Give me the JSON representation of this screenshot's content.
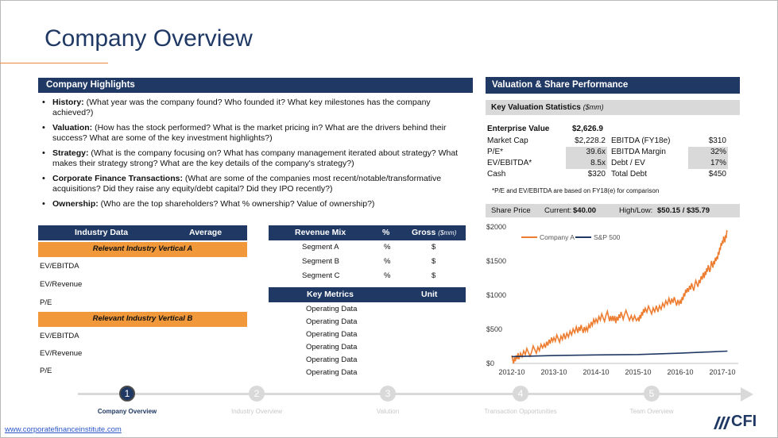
{
  "title": "Company Overview",
  "highlights": {
    "header": "Company Highlights",
    "items": [
      {
        "label": "History:",
        "text": " (What year was the company found? Who founded it? What key milestones has the company achieved?)"
      },
      {
        "label": "Valuation:",
        "text": " (How has the stock performed? What is the market pricing in? What are the drivers behind their success? What are some of the key investment highlights?)"
      },
      {
        "label": "Strategy:",
        "text": " (What is the company focusing on? What has company management iterated about strategy? What makes their strategy strong? What are the key details of the company's strategy?)"
      },
      {
        "label": "Corporate Finance Transactions:",
        "text": " (What are some of the companies most recent/notable/transformative acquisitions? Did they raise any equity/debt capital? Did they IPO recently?)"
      },
      {
        "label": "Ownership:",
        "text": " (Who are the top shareholders? What % ownership? Value of ownership?)"
      }
    ]
  },
  "industry": {
    "col1": "Industry Data",
    "col2": "Average",
    "group_a": "Relevant Industry Vertical A",
    "group_b": "Relevant Industry Vertical B",
    "rows_a": [
      "EV/EBITDA",
      "EV/Revenue",
      "P/E"
    ],
    "rows_b": [
      "EV/EBITDA",
      "EV/Revenue",
      "P/E"
    ]
  },
  "revenue_mix": {
    "col1": "Revenue Mix",
    "col2": "%",
    "col3": "Gross",
    "col3_unit": "($mm)",
    "rows": [
      {
        "name": "Segment A",
        "pct": "%",
        "gross": "$"
      },
      {
        "name": "Segment B",
        "pct": "%",
        "gross": "$"
      },
      {
        "name": "Segment C",
        "pct": "%",
        "gross": "$"
      }
    ]
  },
  "key_metrics": {
    "col1": "Key Metrics",
    "col2": "Unit",
    "rows": [
      "Operating Data",
      "Operating Data",
      "Operating Data",
      "Operating Data",
      "Operating Data",
      "Operating Data"
    ]
  },
  "valuation": {
    "header": "Valuation & Share Performance",
    "kvs_label": "Key Valuation Statistics",
    "kvs_unit": "($mm)",
    "ev_label": "Enterprise Value",
    "ev_value": "$2,626.9",
    "left": [
      {
        "label": "Market Cap",
        "value": "$2,228.2"
      },
      {
        "label": "P/E*",
        "value": "39.6x"
      },
      {
        "label": "EV/EBITDA*",
        "value": "8.5x"
      },
      {
        "label": "Cash",
        "value": "$320"
      }
    ],
    "right": [
      {
        "label": "EBITDA (FY18e)",
        "value": "$310"
      },
      {
        "label": "EBITDA Margin",
        "value": "32%"
      },
      {
        "label": "Debt / EV",
        "value": "17%"
      },
      {
        "label": "Total Debt",
        "value": "$450"
      }
    ],
    "note": "*P/E and EV/EBITDA are based on FY18(e) for comparison"
  },
  "share_price": {
    "label": "Share Price",
    "current_label": "Current:",
    "current_value": "$40.00",
    "hl_label": "High/Low:",
    "hl_value": "$50.15 / $35.79"
  },
  "chart_data": {
    "type": "line",
    "title": "",
    "xlabel": "",
    "ylabel": "",
    "x_ticks": [
      "2012-10",
      "2013-10",
      "2014-10",
      "2015-10",
      "2016-10",
      "2017-10"
    ],
    "y_ticks": [
      "$0",
      "$500",
      "$1000",
      "$1500",
      "$2000"
    ],
    "ylim": [
      0,
      2000
    ],
    "legend_position": "top-left",
    "series": [
      {
        "name": "Company A",
        "color": "#ed7d31",
        "x": [
          2012.83,
          2013.0,
          2013.3,
          2013.6,
          2013.83,
          2014.1,
          2014.4,
          2014.6,
          2014.83,
          2015.1,
          2015.3,
          2015.5,
          2015.83,
          2016.0,
          2016.3,
          2016.6,
          2016.83,
          2017.0,
          2017.2,
          2017.4,
          2017.55,
          2017.7,
          2017.83,
          2017.95
        ],
        "y": [
          50,
          110,
          180,
          270,
          330,
          420,
          480,
          530,
          620,
          700,
          640,
          720,
          650,
          760,
          820,
          900,
          920,
          1070,
          1150,
          1300,
          1420,
          1550,
          1750,
          1930
        ]
      },
      {
        "name": "S&P 500",
        "color": "#1f3864",
        "x": [
          2012.83,
          2013.83,
          2014.83,
          2015.83,
          2016.83,
          2017.95
        ],
        "y": [
          100,
          115,
          125,
          130,
          150,
          180
        ]
      }
    ]
  },
  "steps": [
    {
      "num": "1",
      "label": "Company Overview",
      "active": true
    },
    {
      "num": "2",
      "label": "Industry Overview",
      "active": false
    },
    {
      "num": "3",
      "label": "Valution",
      "active": false
    },
    {
      "num": "4",
      "label": "Transaction Opportunities",
      "active": false
    },
    {
      "num": "5",
      "label": "Team Overview",
      "active": false
    }
  ],
  "footer_link": "www.corporatefinanceinstitute.com",
  "logo_text": "CFI"
}
